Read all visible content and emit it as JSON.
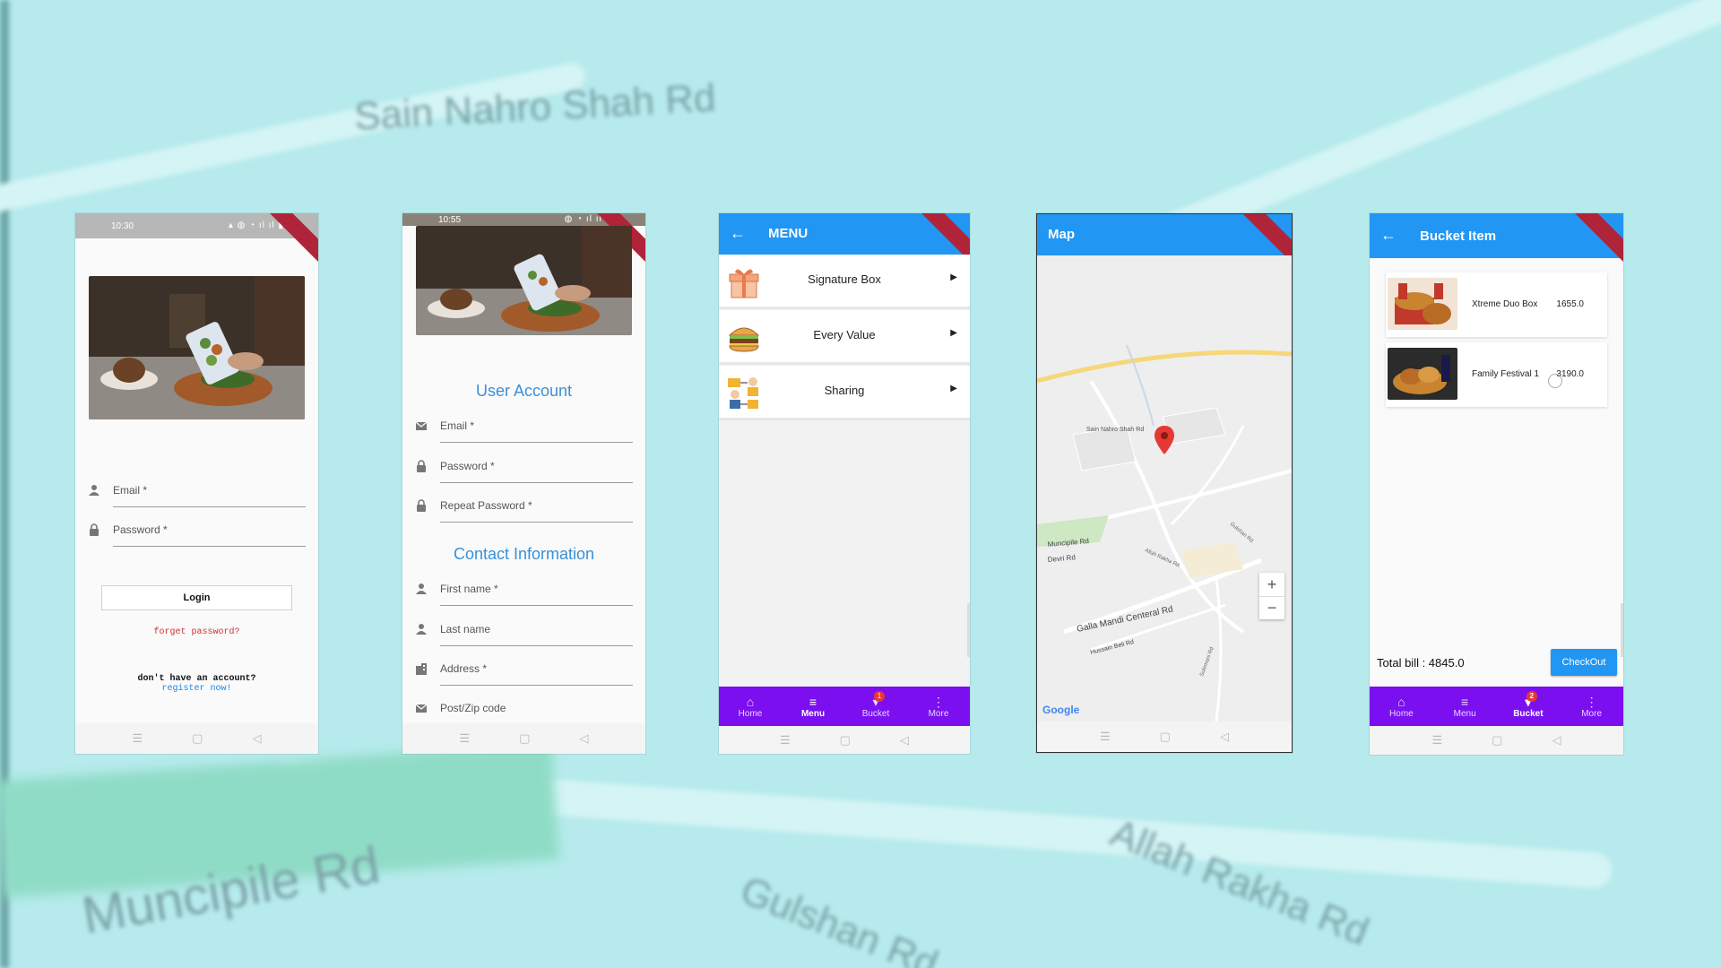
{
  "background": {
    "labels": [
      "Sain Nahro Shah Rd",
      "Muncipile Rd",
      "Allah Rakha Rd",
      "Gulshan Rd"
    ]
  },
  "login": {
    "status_time": "10:30",
    "email_label": "Email *",
    "password_label": "Password *",
    "login_button": "Login",
    "forgot": "forget password?",
    "no_account": "don't have an account?",
    "register": "register now!"
  },
  "register": {
    "status_time": "10:55",
    "user_account_title": "User Account",
    "fields_account": [
      "Email *",
      "Password *",
      "Repeat Password *"
    ],
    "contact_title": "Contact Information",
    "fields_contact": [
      "First name *",
      "Last name",
      "Address *",
      "Post/Zip code"
    ]
  },
  "menu": {
    "title": "MENU",
    "items": [
      {
        "label": "Signature Box",
        "icon": "gift-box-icon"
      },
      {
        "label": "Every Value",
        "icon": "burger-icon"
      },
      {
        "label": "Sharing",
        "icon": "people-sharing-icon"
      }
    ],
    "nav": [
      {
        "label": "Home",
        "icon": "home-icon"
      },
      {
        "label": "Menu",
        "icon": "menu-icon"
      },
      {
        "label": "Bucket",
        "icon": "bucket-icon",
        "badge": "1"
      },
      {
        "label": "More",
        "icon": "more-vertical-icon"
      }
    ],
    "active_tab": "Menu"
  },
  "map": {
    "title": "Map",
    "road_labels": [
      "Sain Nahro Shah Rd",
      "Muncipile Rd",
      "Devri Rd",
      "Galla Mandi Centeral Rd",
      "Hussain Beli Rd",
      "Allah Rakha Rd",
      "Sulemani Rd",
      "Gulshan Rd"
    ],
    "zoom_in": "+",
    "zoom_out": "−",
    "attribution": "Google"
  },
  "bucket": {
    "title": "Bucket Item",
    "items": [
      {
        "name": "Xtreme Duo Box",
        "price": "1655.0"
      },
      {
        "name": "Family Festival 1",
        "price": "3190.0"
      }
    ],
    "total": "Total bill : 4845.0",
    "checkout": "CheckOut",
    "nav": [
      {
        "label": "Home",
        "icon": "home-icon"
      },
      {
        "label": "Menu",
        "icon": "menu-icon"
      },
      {
        "label": "Bucket",
        "icon": "bucket-icon",
        "badge": "2"
      },
      {
        "label": "More",
        "icon": "more-vertical-icon"
      }
    ],
    "active_tab": "Bucket"
  },
  "colors": {
    "primary": "#2196f3",
    "bottom_nav": "#7b0ff0",
    "title_blue": "#3b8fd6",
    "link_red": "#d32f2f",
    "background": "#b6eaec"
  }
}
